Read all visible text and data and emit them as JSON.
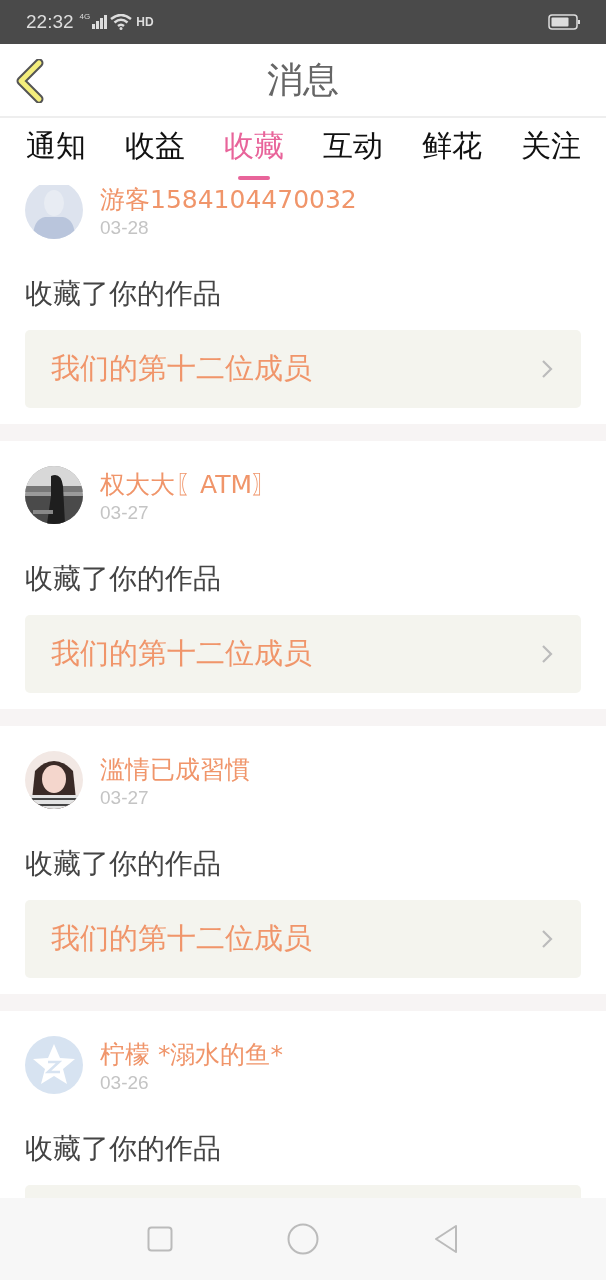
{
  "status_bar": {
    "time": "22:32",
    "network": "4G",
    "hd": "HD"
  },
  "header": {
    "title": "消息"
  },
  "tabs": [
    {
      "label": "通知",
      "selected": false
    },
    {
      "label": "收益",
      "selected": false
    },
    {
      "label": "收藏",
      "selected": true
    },
    {
      "label": "互动",
      "selected": false
    },
    {
      "label": "鲜花",
      "selected": false
    },
    {
      "label": "关注",
      "selected": false
    }
  ],
  "messages": [
    {
      "user": "游客1584104470032",
      "date": "03-28",
      "kind": "default",
      "action": "收藏了你的作品",
      "work": "我们的第十二位成员"
    },
    {
      "user": "权大大〖ATM〗",
      "date": "03-27",
      "action": "收藏了你的作品",
      "work": "我们的第十二位成员"
    },
    {
      "user": "滥情已成習慣",
      "date": "03-27",
      "action": "收藏了你的作品",
      "work": "我们的第十二位成员"
    },
    {
      "user": "柠檬 *溺水的鱼*",
      "date": "03-26",
      "kind": "star",
      "action": "收藏了你的作品"
    }
  ]
}
